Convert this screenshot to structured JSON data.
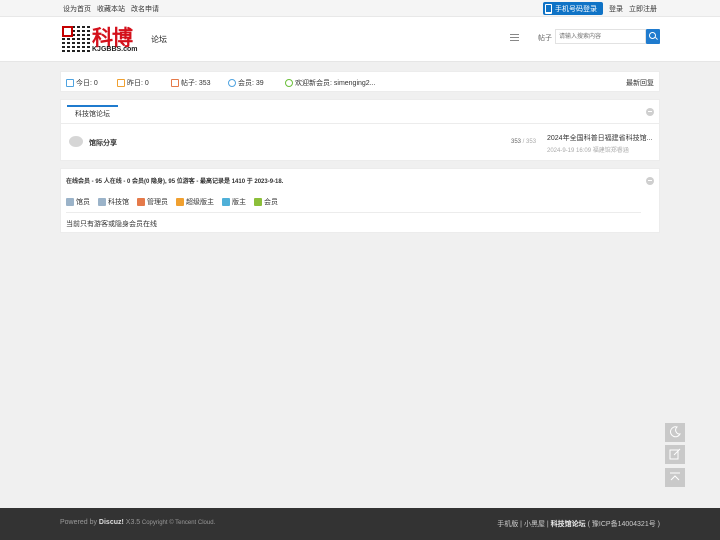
{
  "topbar": {
    "set_home": "设为首页",
    "bookmark": "收藏本站",
    "rename": "改名申请",
    "mobile_login": "手机号码登录",
    "login": "登录",
    "register": "立即注册"
  },
  "header": {
    "logo_text": "科博",
    "logo_sub": "KJGBBS.com",
    "nav_forum": "论坛",
    "search_type": "帖子",
    "search_placeholder": "请输入搜索内容"
  },
  "stats": {
    "today": "今日: 0",
    "yesterday": "昨日: 0",
    "posts": "帖子: 353",
    "members": "会员: 39",
    "welcome": "欢迎新会员: simenging2...",
    "latest_reply": "最新回复"
  },
  "forum": {
    "tab": "科技馆论坛",
    "board_name": "馆际分享",
    "threads": "353",
    "sep": " / ",
    "posts": "353",
    "last_title": "2024年全国科普日福建省科技馆...",
    "last_meta": "2024-9-19 16:09 福建馆郑睿涵"
  },
  "online": {
    "title": "在线会员",
    "summary": " - 95 人在线 - 0 会员(0 隐身), 95 位游客 - 最高记录是 1410 于 2023-9-18.",
    "legend": [
      {
        "label": "馆员",
        "color": "#9bb3c9"
      },
      {
        "label": "科技馆",
        "color": "#9bb3c9"
      },
      {
        "label": "管理员",
        "color": "#e57a4a"
      },
      {
        "label": "超级版主",
        "color": "#f0a030"
      },
      {
        "label": "版主",
        "color": "#4fb0d8"
      },
      {
        "label": "会员",
        "color": "#8cbf3a"
      }
    ],
    "note": "当前只有游客或隐身会员在线"
  },
  "footer": {
    "powered": "Powered by ",
    "discuz": "Discuz!",
    "version": " X3.5",
    "copyright": " Copyright © Tencent Cloud.",
    "mobile": "手机版",
    "dark": "小黑屋",
    "forum_name": "科技馆论坛",
    "icp": "( 豫ICP备14004321号 )"
  },
  "colors": {
    "accent": "#1f7bce",
    "logo_red": "#d4101b",
    "footer_bg": "#333333"
  }
}
